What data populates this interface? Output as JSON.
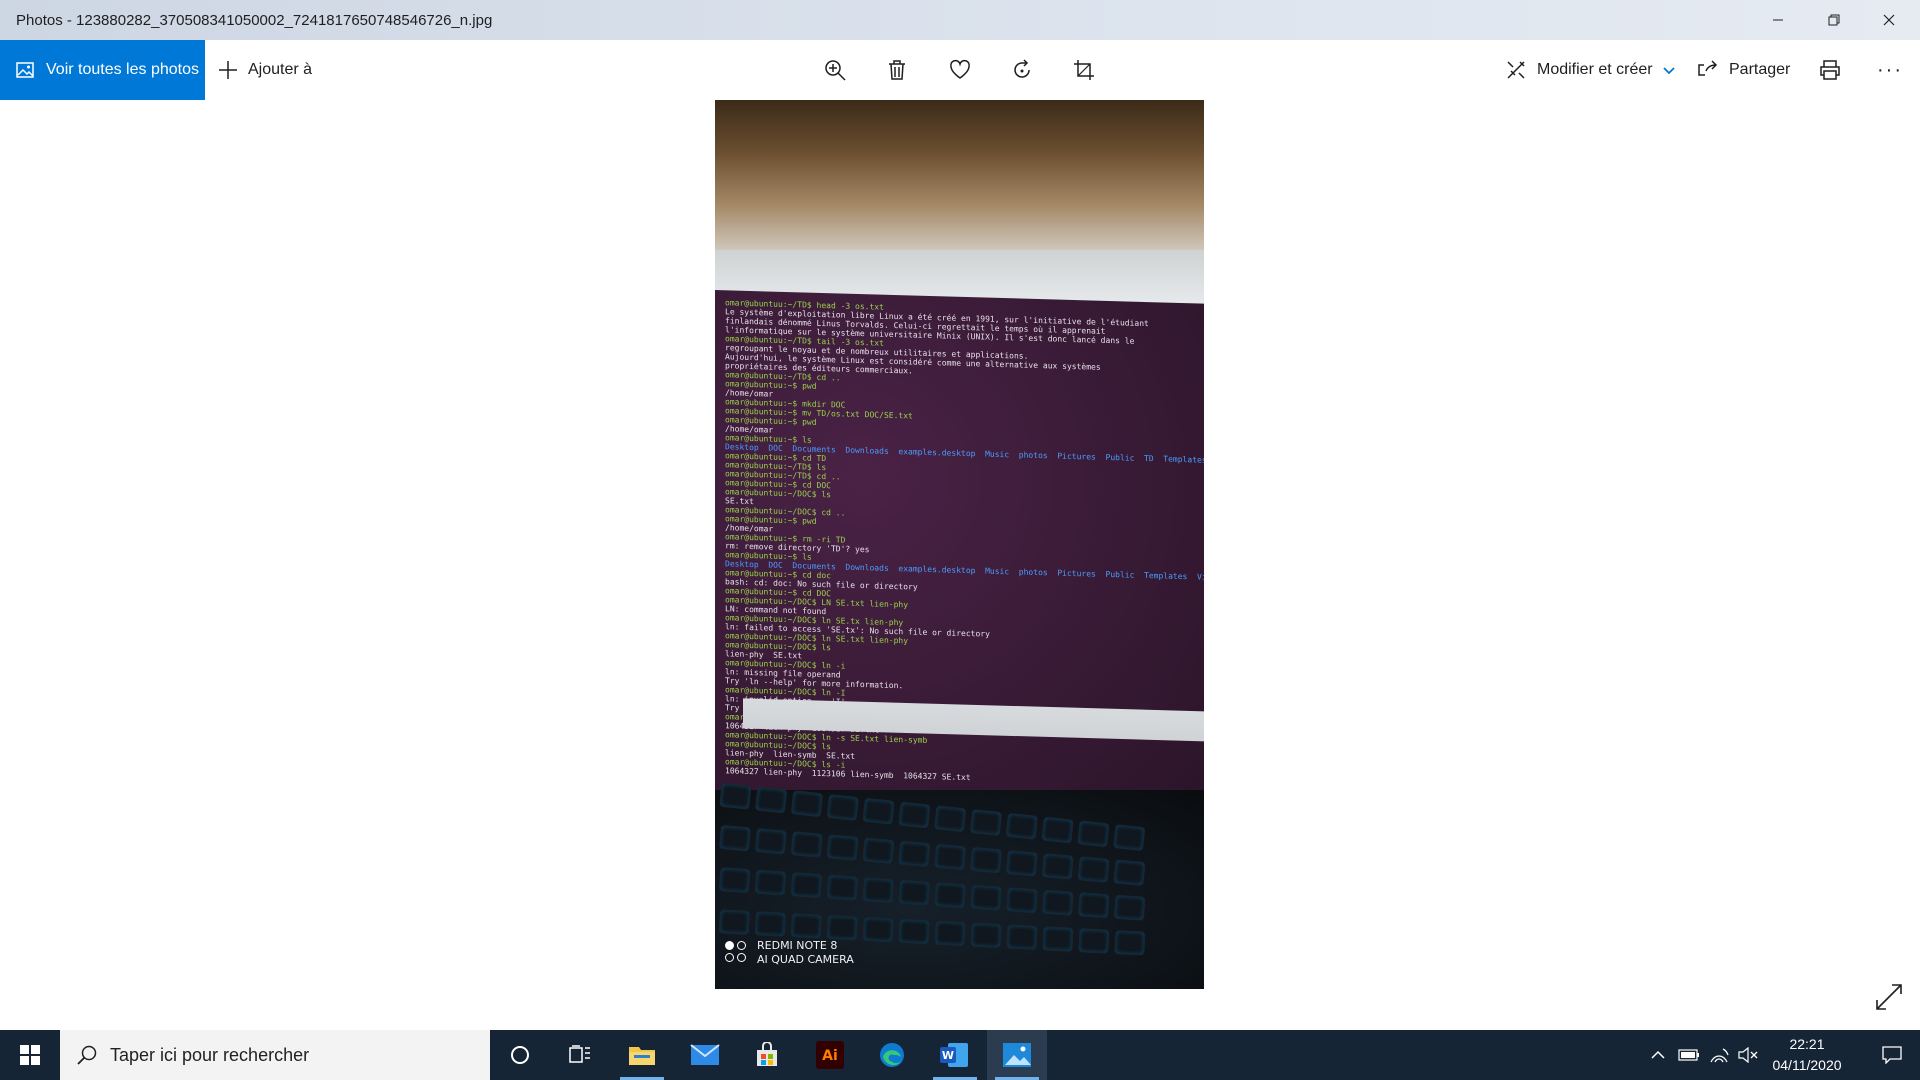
{
  "window": {
    "title": "Photos - 123880282_370508341050002_7241817650748546726_n.jpg"
  },
  "toolbar": {
    "all_photos_label": "Voir toutes les photos",
    "add_to_label": "Ajouter à",
    "edit_create_label": "Modifier et créer",
    "share_label": "Partager",
    "more_label": "···"
  },
  "photo": {
    "terminal_lines": [
      "omar@ubuntuu:~/TD$ head -3 os.txt",
      "Le système d'exploitation libre Linux a été créé en 1991, sur l'initiative de l'étudiant",
      "finlandais dénommé Linus Torvalds. Celui-ci regrettait le temps où il apprenait",
      "l'informatique sur le système universitaire Minix (UNIX). Il s'est donc lancé dans le",
      "omar@ubuntuu:~/TD$ tail -3 os.txt",
      "regroupant le noyau et de nombreux utilitaires et applications.",
      "Aujourd'hui, le système Linux est considéré comme une alternative aux systèmes",
      "propriétaires des éditeurs commerciaux.",
      "omar@ubuntuu:~/TD$ cd ..",
      "omar@ubuntuu:~$ pwd",
      "/home/omar",
      "omar@ubuntuu:~$ mkdir DOC",
      "omar@ubuntuu:~$ mv TD/os.txt DOC/SE.txt",
      "omar@ubuntuu:~$ pwd",
      "/home/omar",
      "omar@ubuntuu:~$ ls",
      "Desktop  DOC  Documents  Downloads  examples.desktop  Music  photos  Pictures  Public  TD  Templates",
      "omar@ubuntuu:~$ cd TD",
      "omar@ubuntuu:~/TD$ ls",
      "omar@ubuntuu:~/TD$ cd ..",
      "omar@ubuntuu:~$ cd DOC",
      "omar@ubuntuu:~/DOC$ ls",
      "SE.txt",
      "omar@ubuntuu:~/DOC$ cd ..",
      "omar@ubuntuu:~$ pwd",
      "/home/omar",
      "omar@ubuntuu:~$ rm -ri TD",
      "rm: remove directory 'TD'? yes",
      "omar@ubuntuu:~$ ls",
      "Desktop  DOC  Documents  Downloads  examples.desktop  Music  photos  Pictures  Public  Templates  Videos",
      "omar@ubuntuu:~$ cd doc",
      "bash: cd: doc: No such file or directory",
      "omar@ubuntuu:~$ cd DOC",
      "omar@ubuntuu:~/DOC$ LN SE.txt lien-phy",
      "LN: command not found",
      "omar@ubuntuu:~/DOC$ ln SE.tx lien-phy",
      "ln: failed to access 'SE.tx': No such file or directory",
      "omar@ubuntuu:~/DOC$ ln SE.txt lien-phy",
      "omar@ubuntuu:~/DOC$ ls",
      "lien-phy  SE.txt",
      "omar@ubuntuu:~/DOC$ ln -i",
      "ln: missing file operand",
      "Try 'ln --help' for more information.",
      "omar@ubuntuu:~/DOC$ ln -I",
      "ln: invalid option -- 'I'",
      "Try 'ln --help' for more information.",
      "omar@ubuntuu:~/DOC$ ls -i",
      "1064327 lien-phy  1064327 SE.txt",
      "omar@ubuntuu:~/DOC$ ln -s SE.txt lien-symb",
      "omar@ubuntuu:~/DOC$ ls",
      "lien-phy  lien-symb  SE.txt",
      "omar@ubuntuu:~/DOC$ ls -i",
      "1064327 lien-phy  1123106 lien-symb  1064327 SE.txt"
    ],
    "watermark_line1": "REDMI NOTE 8",
    "watermark_line2": "AI QUAD CAMERA"
  },
  "taskbar": {
    "search_placeholder": "Taper ici pour rechercher",
    "time": "22:21",
    "date": "04/11/2020",
    "accent": "#0078d7"
  }
}
